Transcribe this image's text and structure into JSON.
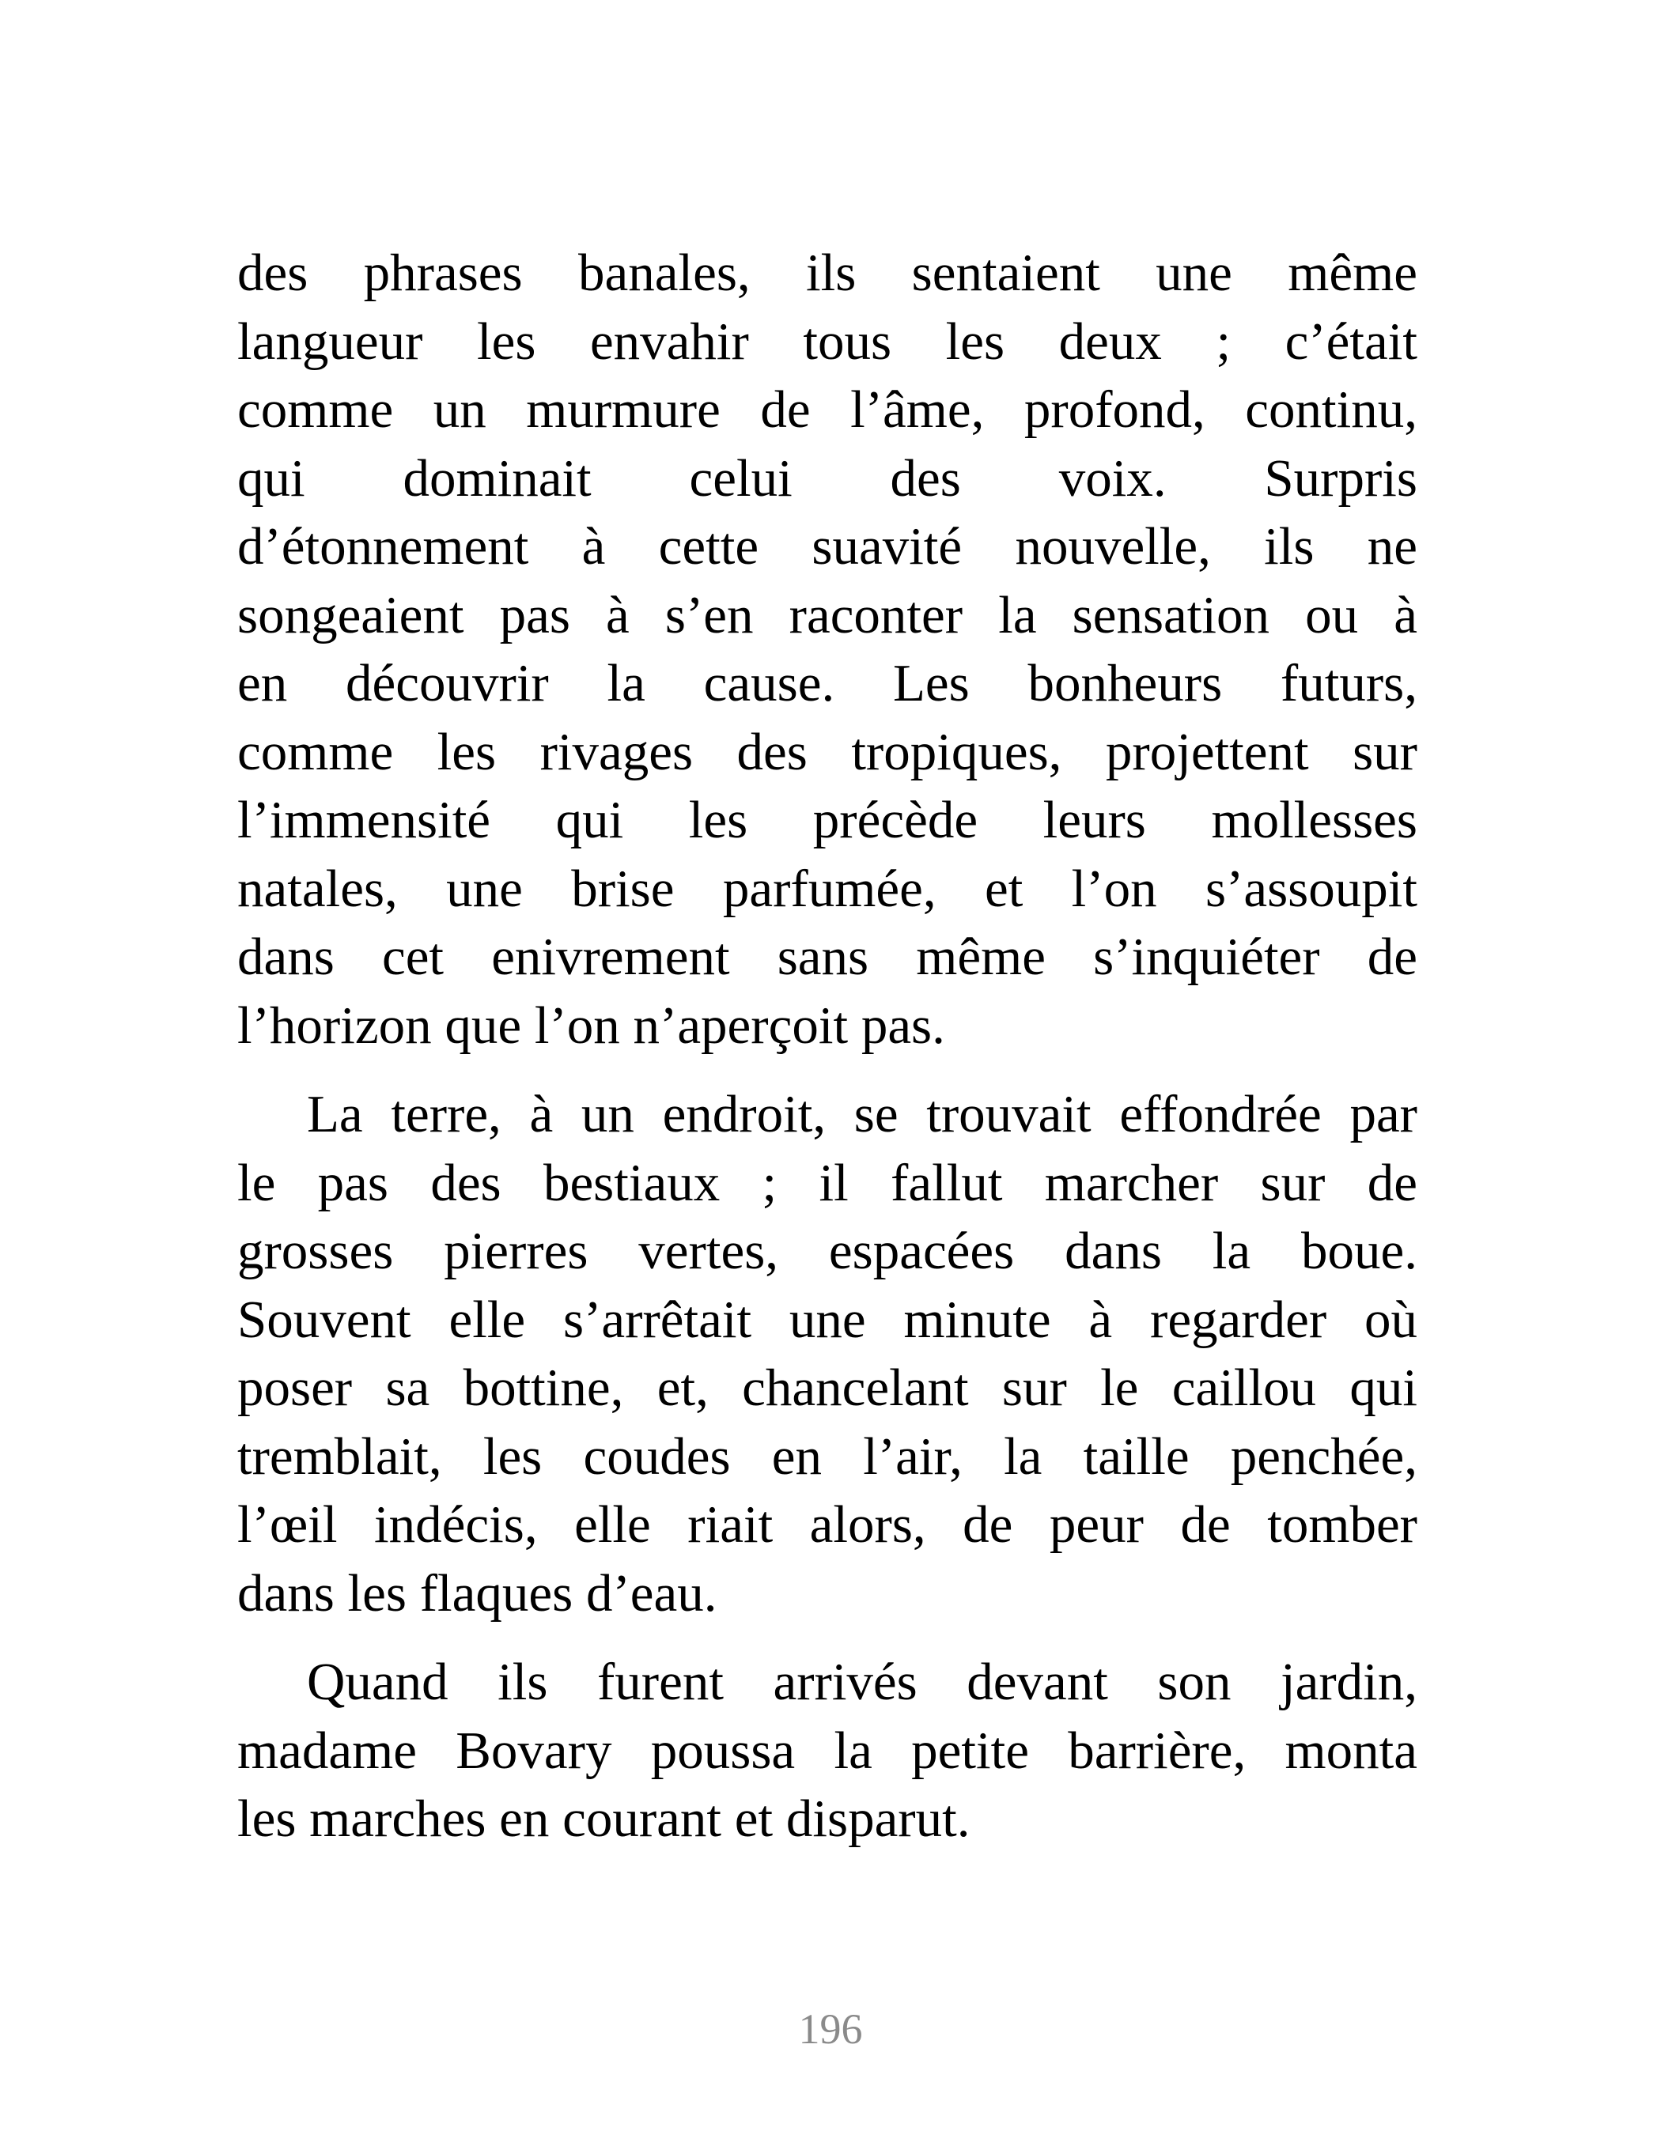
{
  "page": {
    "page_number": "196",
    "paragraphs": [
      {
        "indent": false,
        "lines": [
          "des phrases banales, ils sentaient une même",
          "langueur les envahir tous les deux ; c’était",
          "comme un murmure de l’âme, profond, continu,",
          "qui dominait celui des voix. Surpris",
          "d’étonnement à cette suavité nouvelle, ils ne",
          "songeaient pas à s’en raconter la sensation ou à",
          "en découvrir la cause. Les bonheurs futurs,",
          "comme les rivages des tropiques, projettent sur",
          "l’immensité qui les précède leurs mollesses",
          "natales, une brise parfumée, et l’on s’assoupit",
          "dans cet enivrement sans même s’inquiéter de",
          "l’horizon que l’on n’aperçoit pas."
        ]
      },
      {
        "indent": true,
        "lines": [
          "La terre, à un endroit, se trouvait effondrée par",
          "le pas des bestiaux ; il fallut marcher sur de",
          "grosses pierres vertes, espacées dans la boue.",
          "Souvent elle s’arrêtait une minute à regarder où",
          "poser sa bottine, et, chancelant sur le caillou qui",
          "tremblait, les coudes en l’air, la taille penchée,",
          "l’œil indécis, elle riait alors, de peur de tomber",
          "dans les flaques d’eau."
        ]
      },
      {
        "indent": true,
        "lines": [
          "Quand ils furent arrivés devant son jardin,",
          "madame Bovary poussa la petite barrière, monta",
          "les marches en courant et disparut."
        ]
      }
    ]
  }
}
